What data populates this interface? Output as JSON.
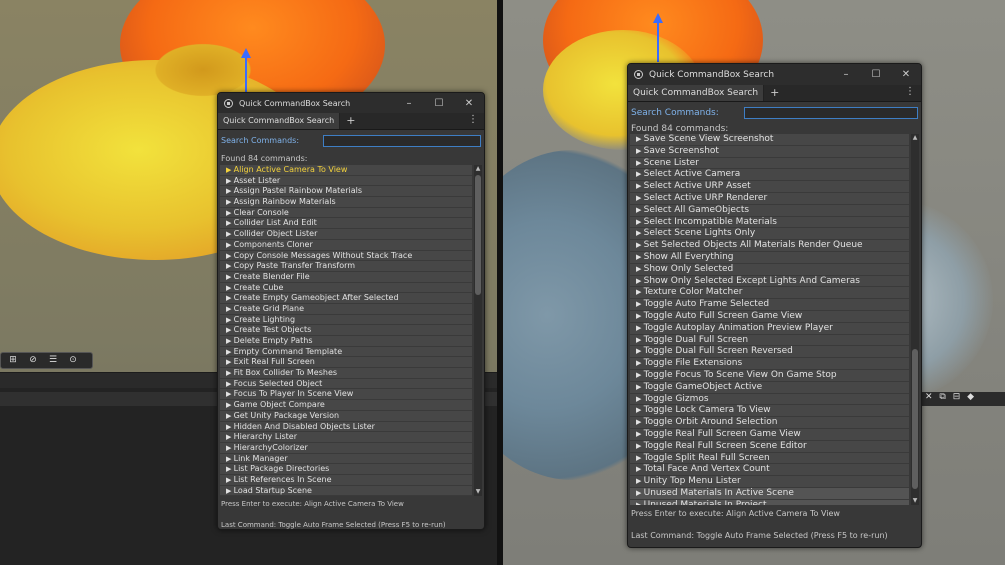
{
  "window": {
    "title": "Quick CommandBox Search",
    "tab": "Quick CommandBox Search",
    "search_label": "Search Commands:",
    "search_value": "",
    "found_text": "Found 84 commands:",
    "execute_hint": "Press Enter to execute: Align Active Camera To View",
    "last_command": "Last Command: Toggle Auto Frame Selected (Press F5 to re-run)"
  },
  "icons": {
    "app": "unity-logo-icon",
    "minimize": "minimize-icon",
    "maximize": "maximize-icon",
    "close": "close-icon",
    "add_tab": "plus-icon",
    "menu": "kebab-menu-icon"
  },
  "colors": {
    "highlight": "#f3d23c",
    "label": "#7fb2ea",
    "search_border": "#3e7ec4"
  },
  "left_list": [
    "Align Active Camera To View",
    "Asset Lister",
    "Assign Pastel Rainbow Materials",
    "Assign Rainbow Materials",
    "Clear Console",
    "Collider List And Edit",
    "Collider Object Lister",
    "Components Cloner",
    "Copy  Console Messages Without Stack Trace",
    "Copy Paste Transfer Transform",
    "Create Blender File",
    "Create Cube",
    "Create Empty Gameobject After Selected",
    "Create Grid Plane",
    "Create Lighting",
    "Create Test Objects",
    "Delete Empty Paths",
    "Empty Command Template",
    "Exit Real Full Screen",
    "Fit Box Collider To Meshes",
    "Focus Selected Object",
    "Focus To Player In Scene View",
    "Game Object Compare",
    "Get Unity Package Version",
    "Hidden And Disabled Objects Lister",
    "Hierarchy Lister",
    "HierarchyColorizer",
    "Link Manager",
    "List Package Directories",
    "List References In Scene",
    "Load Startup Scene"
  ],
  "right_list": [
    "Save Scene View Screenshot",
    "Save Screenshot",
    "Scene Lister",
    "Select Active Camera",
    "Select Active URP Asset",
    "Select Active URP Renderer",
    "Select All GameObjects",
    "Select Incompatible Materials",
    "Select Scene Lights Only",
    "Set Selected Objects All Materials Render Queue",
    "Show All Everything",
    "Show Only Selected",
    "Show Only Selected Except Lights And Cameras",
    "Texture Color Matcher",
    "Toggle Auto Frame Selected",
    "Toggle Auto Full Screen Game View",
    "Toggle Autoplay Animation Preview Player",
    "Toggle Dual Full Screen",
    "Toggle Dual Full Screen Reversed",
    "Toggle File Extensions",
    "Toggle Focus To Scene View On Game Stop",
    "Toggle GameObject Active",
    "Toggle Gizmos",
    "Toggle Lock Camera To View",
    "Toggle Orbit Around Selection",
    "Toggle Real Full Screen Game View",
    "Toggle Real Full Screen Scene Editor",
    "Toggle Split Real Full Screen",
    "Total Face And Vertex Count",
    "Unity Top Menu Lister",
    "Unused Materials In Active Scene",
    "Unused Materials In Project"
  ]
}
